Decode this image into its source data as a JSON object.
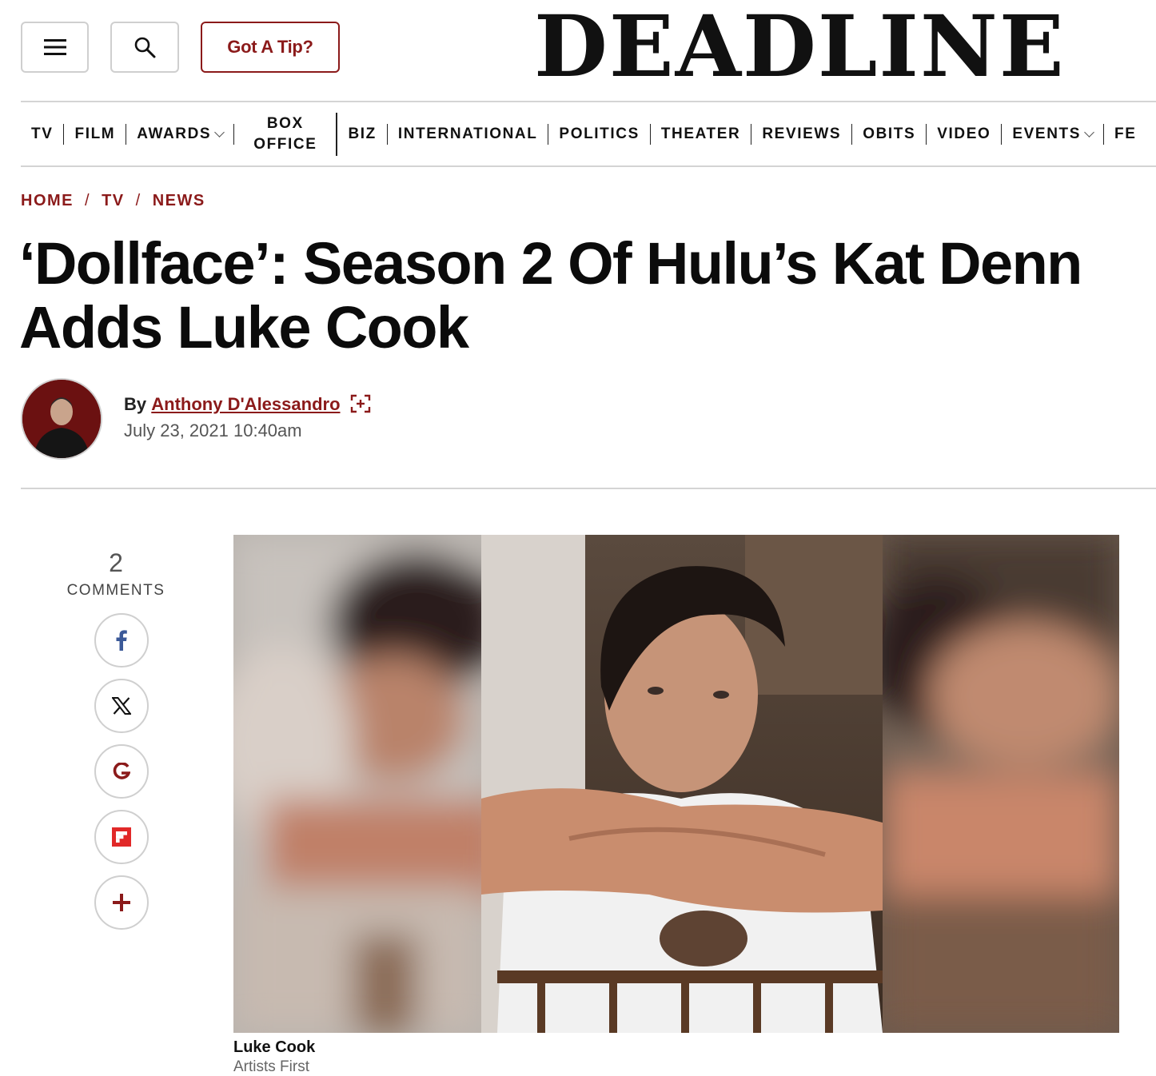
{
  "header": {
    "tip_button": "Got A Tip?",
    "logo": "DEADLINE"
  },
  "nav": {
    "items": [
      "TV",
      "FILM",
      "AWARDS",
      "BIZ",
      "INTERNATIONAL",
      "POLITICS",
      "THEATER",
      "REVIEWS",
      "OBITS",
      "VIDEO",
      "EVENTS",
      "FE"
    ],
    "box_office": [
      "BOX",
      "OFFICE"
    ]
  },
  "breadcrumb": [
    "HOME",
    "TV",
    "NEWS"
  ],
  "article": {
    "headline_line1": "‘Dollface’: Season 2 Of Hulu’s Kat Denn",
    "headline_line2": "Adds Luke Cook",
    "by": "By",
    "author": "Anthony D'Alessandro",
    "date": "July 23, 2021 10:40am"
  },
  "comments": {
    "count": "2",
    "label": "COMMENTS"
  },
  "share_icons": [
    "facebook-icon",
    "x-icon",
    "google-icon",
    "flipboard-icon",
    "plus-icon"
  ],
  "image": {
    "caption": "Luke Cook",
    "credit": "Artists First"
  },
  "colors": {
    "accent": "#8b1a1a",
    "facebook": "#3b5998",
    "flipboard": "#e12828"
  }
}
